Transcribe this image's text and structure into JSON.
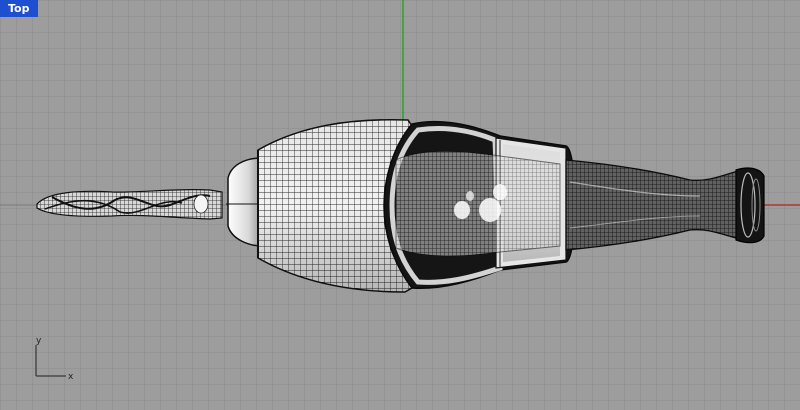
{
  "viewport": {
    "name": "Top",
    "background_color": "#9d9d9d",
    "grid_color": "#8a8a8a",
    "major_grid_color": "#7a7a7a",
    "x_axis_color": "#b02020",
    "y_axis_color": "#10a010",
    "tab_color": "#1f4fd1"
  },
  "axis_gizmo": {
    "x_label": "x",
    "y_label": "y"
  }
}
